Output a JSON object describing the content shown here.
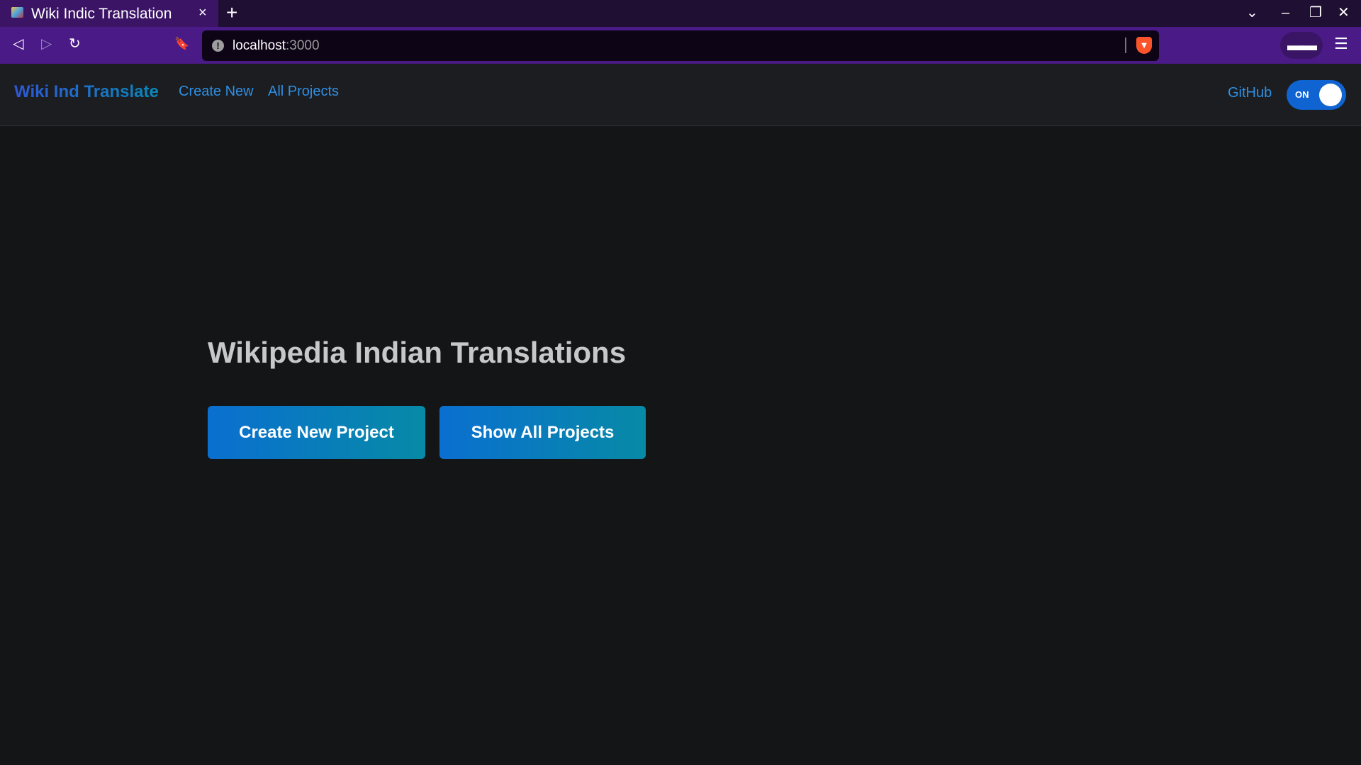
{
  "browser": {
    "tab_title": "Wiki Indic Translation",
    "tab_close": "×",
    "new_tab": "+",
    "window_controls": {
      "tab_list": "⌄",
      "minimize": "–",
      "restore": "❐",
      "close": "✕"
    },
    "nav": {
      "back": "◁",
      "forward": "▷",
      "reload": "↻",
      "bookmark": "🔖"
    },
    "url": {
      "host": "localhost",
      "port": ":3000"
    },
    "menu": "☰",
    "extension_glyph": "▬▬"
  },
  "app_nav": {
    "brand": "Wiki Ind Translate",
    "links": [
      "Create New",
      "All Projects"
    ],
    "github": "GitHub",
    "toggle": {
      "label": "ON",
      "state": "on"
    }
  },
  "hero": {
    "title": "Wikipedia Indian Translations",
    "buttons": {
      "create": "Create New Project",
      "show_all": "Show All Projects"
    }
  },
  "colors": {
    "page_bg": "#141517",
    "tabbar_bg": "#1f0f33",
    "toolbar_bg": "#4a1a87",
    "navbar_bg": "#1b1d21",
    "link": "#2f8fe3",
    "button_gradient_start": "#0a6fd0",
    "button_gradient_end": "#078aa6",
    "toggle_on": "#0f64d2"
  }
}
